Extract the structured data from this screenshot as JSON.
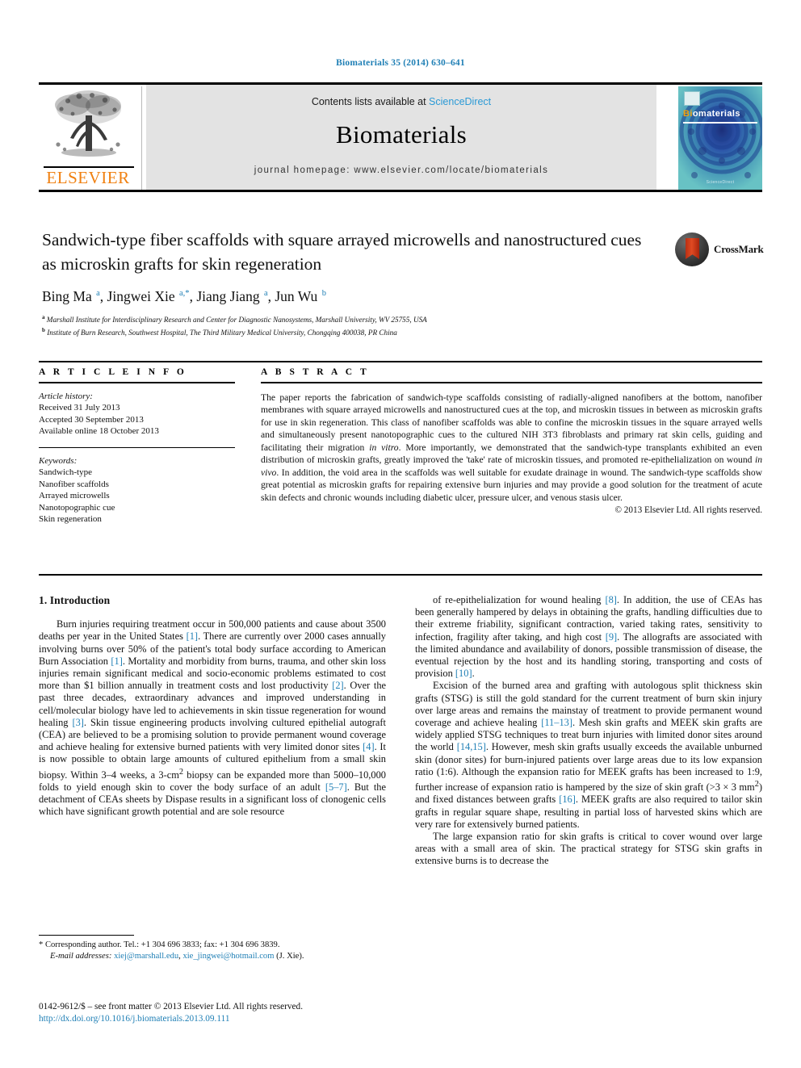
{
  "running_head": "Biomaterials 35 (2014) 630–641",
  "masthead": {
    "contents_prefix": "Contents lists available at ",
    "sciencedirect": "ScienceDirect",
    "journal_name": "Biomaterials",
    "homepage": "journal homepage: www.elsevier.com/locate/biomaterials",
    "publisher_name": "ELSEVIER",
    "cover_title_first": "Bi",
    "cover_title_rest": "omaterials",
    "cover_footer": "ScienceDirect"
  },
  "crossmark": {
    "label": "CrossMark"
  },
  "article": {
    "title": "Sandwich-type fiber scaffolds with square arrayed microwells and nanostructured cues as microskin grafts for skin regeneration",
    "authors_html": "Bing Ma <sup>a</sup>, Jingwei Xie <sup>a,*</sup>, Jiang Jiang <sup>a</sup>, Jun Wu <sup>b</sup>",
    "affiliation_a": "Marshall Institute for Interdisciplinary Research and Center for Diagnostic Nanosystems, Marshall University, WV 25755, USA",
    "affiliation_b": "Institute of Burn Research, Southwest Hospital, The Third Military Medical University, Chongqing 400038, PR China"
  },
  "article_info": {
    "heading": "A R T I C L E  I N F O",
    "history_label": "Article history:",
    "history": [
      "Received 31 July 2013",
      "Accepted 30 September 2013",
      "Available online 18 October 2013"
    ],
    "keywords_label": "Keywords:",
    "keywords": [
      "Sandwich-type",
      "Nanofiber scaffolds",
      "Arrayed microwells",
      "Nanotopographic cue",
      "Skin regeneration"
    ]
  },
  "abstract": {
    "heading": "A B S T R A C T",
    "text_html": "The paper reports the fabrication of sandwich-type scaffolds consisting of radially-aligned nanofibers at the bottom, nanofiber membranes with square arrayed microwells and nanostructured cues at the top, and microskin tissues in between as microskin grafts for use in skin regeneration. This class of nanofiber scaffolds was able to confine the microskin tissues in the square arrayed wells and simultaneously present nanotopographic cues to the cultured NIH 3T3 fibroblasts and primary rat skin cells, guiding and facilitating their migration <i>in vitro</i>. More importantly, we demonstrated that the sandwich-type transplants exhibited an even distribution of microskin grafts, greatly improved the 'take' rate of microskin tissues, and promoted re-epithelialization on wound <i>in vivo</i>. In addition, the void area in the scaffolds was well suitable for exudate drainage in wound. The sandwich-type scaffolds show great potential as microskin grafts for repairing extensive burn injuries and may provide a good solution for the treatment of acute skin defects and chronic wounds including diabetic ulcer, pressure ulcer, and venous stasis ulcer.",
    "copyright": "© 2013 Elsevier Ltd. All rights reserved."
  },
  "introduction": {
    "heading": "1. Introduction",
    "left_paragraph_html": "Burn injuries requiring treatment occur in 500,000 patients and cause about 3500 deaths per year in the United States <span class=\"ref\">[1]</span>. There are currently over 2000 cases annually involving burns over 50% of the patient's total body surface according to American Burn Association <span class=\"ref\">[1]</span>. Mortality and morbidity from burns, trauma, and other skin loss injuries remain significant medical and socio-economic problems estimated to cost more than $1 billion annually in treatment costs and lost productivity <span class=\"ref\">[2]</span>. Over the past three decades, extraordinary advances and improved understanding in cell/molecular biology have led to achievements in skin tissue regeneration for wound healing <span class=\"ref\">[3]</span>. Skin tissue engineering products involving cultured epithelial autograft (CEA) are believed to be a promising solution to provide permanent wound coverage and achieve healing for extensive burned patients with very limited donor sites <span class=\"ref\">[4]</span>. It is now possible to obtain large amounts of cultured epithelium from a small skin biopsy. Within 3–4 weeks, a 3-cm<sup>2</sup> biopsy can be expanded more than 5000–10,000 folds to yield enough skin to cover the body surface of an adult <span class=\"ref\">[5–7]</span>. But the detachment of CEAs sheets by Dispase results in a significant loss of clonogenic cells which have significant growth potential and are sole resource",
    "right_paragraph_1_html": "of re-epithelialization for wound healing <span class=\"ref\">[8]</span>. In addition, the use of CEAs has been generally hampered by delays in obtaining the grafts, handling difficulties due to their extreme friability, significant contraction, varied taking rates, sensitivity to infection, fragility after taking, and high cost <span class=\"ref\">[9]</span>. The allografts are associated with the limited abundance and availability of donors, possible transmission of disease, the eventual rejection by the host and its handling storing, transporting and costs of provision <span class=\"ref\">[10]</span>.",
    "right_paragraph_2_html": "Excision of the burned area and grafting with autologous split thickness skin grafts (STSG) is still the gold standard for the current treatment of burn skin injury over large areas and remains the mainstay of treatment to provide permanent wound coverage and achieve healing <span class=\"ref\">[11–13]</span>. Mesh skin grafts and MEEK skin grafts are widely applied STSG techniques to treat burn injuries with limited donor sites around the world <span class=\"ref\">[14,15]</span>. However, mesh skin grafts usually exceeds the available unburned skin (donor sites) for burn-injured patients over large areas due to its low expansion ratio (1:6). Although the expansion ratio for MEEK grafts has been increased to 1:9, further increase of expansion ratio is hampered by the size of skin graft (&gt;3 &#215; 3 mm<sup>2</sup>) and fixed distances between grafts <span class=\"ref\">[16]</span>. MEEK grafts are also required to tailor skin grafts in regular square shape, resulting in partial loss of harvested skins which are very rare for extensively burned patients.",
    "right_paragraph_3_html": "The large expansion ratio for skin grafts is critical to cover wound over large areas with a small area of skin. The practical strategy for STSG skin grafts in extensive burns is to decrease the"
  },
  "footnote": {
    "corresponding_html": "* Corresponding author. Tel.: +1 304 696 3833; fax: +1 304 696 3839.",
    "email_label": "E-mail addresses:",
    "email_1": "xiej@marshall.edu",
    "email_2": "xie_jingwei@hotmail.com",
    "email_suffix": "(J. Xie)."
  },
  "imprint": {
    "line_1": "0142-9612/$ – see front matter © 2013 Elsevier Ltd. All rights reserved.",
    "doi": "http://dx.doi.org/10.1016/j.biomaterials.2013.09.111"
  },
  "colors": {
    "link": "#1f7fb5",
    "sciencedirect": "#2b9ad6",
    "elsevier_orange": "#f08010",
    "masthead_bg": "#e3e3e3"
  }
}
